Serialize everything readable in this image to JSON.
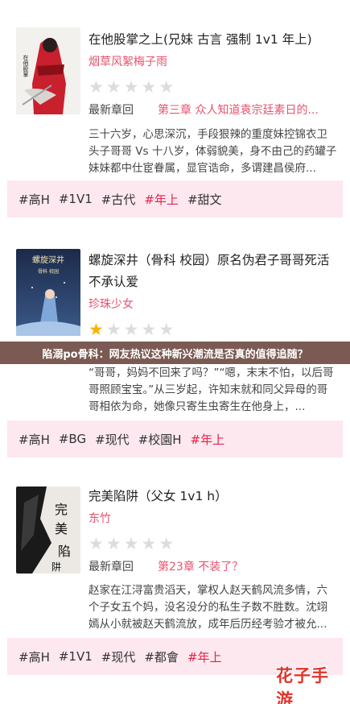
{
  "banner": "陷溺po骨科：网友热议这种新兴潮流是否真的值得追随？",
  "latest_label": "最新章回",
  "watermark": "花子手游",
  "books": [
    {
      "title": "在他股掌之上(兄妹 古言 强制 1v1 年上)",
      "author": "烟草风絮梅子雨",
      "rating": 0,
      "latest_chapter": "第三章 众人知道袁宗廷素日的...",
      "description": "三十六岁，心思深沉，手段狠辣的重度妹控锦衣卫头子哥哥 Vs 十八岁，体弱貌美，身不由己的药罐子妹妹都中仕宦眷属，显官诰命，多谓建昌侯府...",
      "tags": [
        "#高H",
        "#1V1",
        "#古代",
        "#年上",
        "#甜文"
      ],
      "hot_tag_index": 3
    },
    {
      "title": "螺旋深井（骨科 校园）原名伪君子哥哥死活不承认爱",
      "author": "珍珠少女",
      "rating": 1,
      "latest_chapter": "",
      "description": "“哥哥，妈妈不回来了吗？”“嗯，末末不怕，以后哥哥照顾宝宝。”从三岁起，许知末就和同父异母的哥哥相依为命，她像只寄生虫寄生在他身上，...",
      "tags": [
        "#高H",
        "#BG",
        "#现代",
        "#校園H",
        "#年上"
      ],
      "hot_tag_index": 4
    },
    {
      "title": "完美陷阱（父女 1v1 h）",
      "author": "东竹",
      "rating": 0,
      "latest_chapter": "第23章 不装了？",
      "description": "赵家在江浔富贵滔天，掌权人赵天鹤风流多情，六个子女五个妈，没名没分的私生子数不胜数。沈翊嫣从小就被赵天鹤流放，成年后历经考验才被允...",
      "tags": [
        "#高H",
        "#1V1",
        "#现代",
        "#都會",
        "#年上"
      ],
      "hot_tag_index": 4
    }
  ]
}
